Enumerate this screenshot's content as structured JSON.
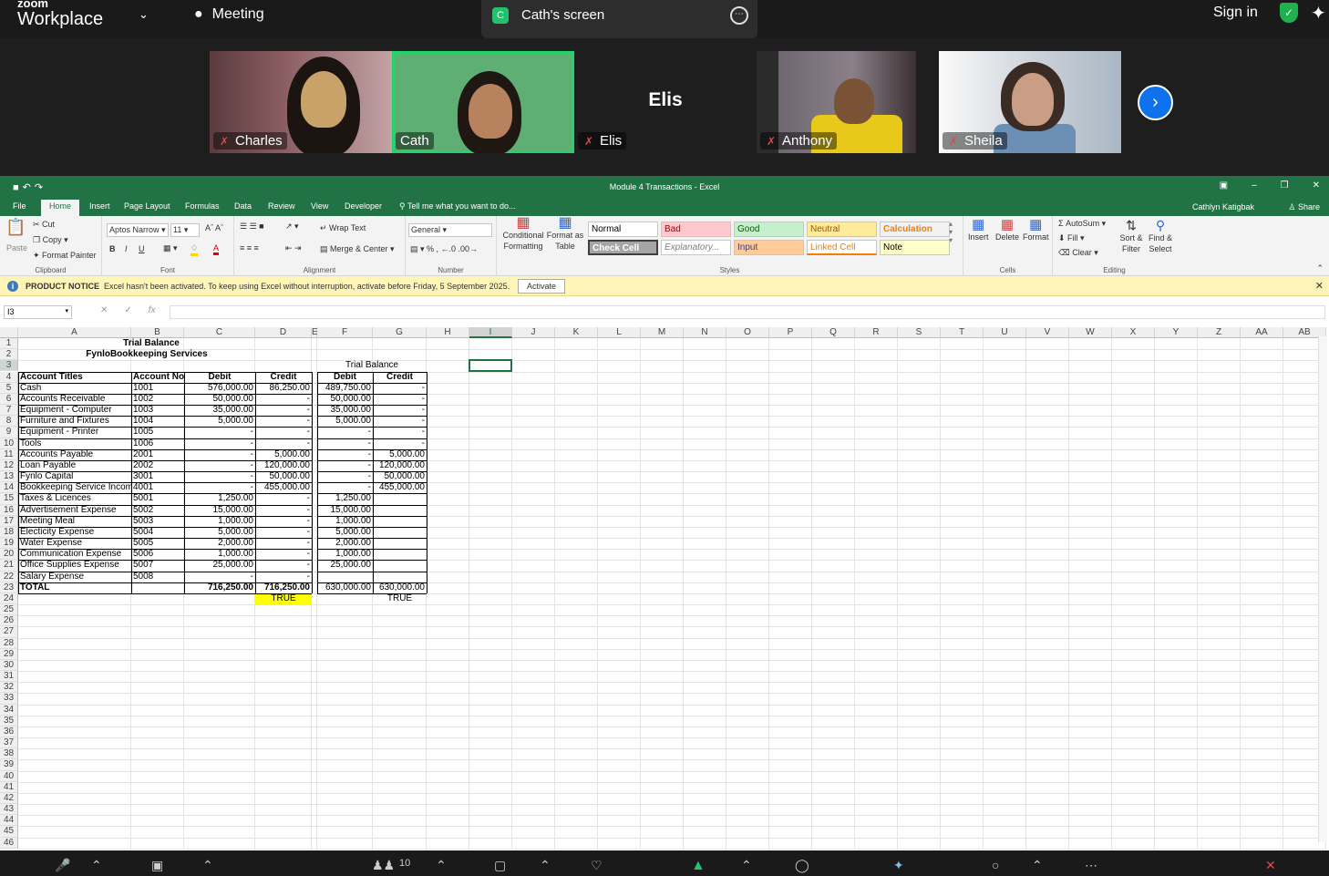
{
  "zoom": {
    "brand_small": "zoom",
    "brand": "Workplace",
    "meeting_label": "Meeting",
    "share_badge": "C",
    "share_title": "Cath's screen",
    "sign_in": "Sign in"
  },
  "participants": [
    {
      "name": "Charles",
      "muted": true
    },
    {
      "name": "Cath",
      "muted": false,
      "active": true
    },
    {
      "name": "Elis",
      "muted": true,
      "video_off": true
    },
    {
      "name": "Anthony",
      "muted": true
    },
    {
      "name": "Sheila",
      "muted": true
    }
  ],
  "excel": {
    "doc_title": "Module 4 Transactions - Excel",
    "tabs": [
      "File",
      "Home",
      "Insert",
      "Page Layout",
      "Formulas",
      "Data",
      "Review",
      "View",
      "Developer"
    ],
    "tell_me": "Tell me what you want to do...",
    "account": "Cathlyn Katigbak",
    "share": "Share",
    "clipboard": {
      "paste": "Paste",
      "cut": "Cut",
      "copy": "Copy",
      "format_painter": "Format Painter",
      "label": "Clipboard"
    },
    "font": {
      "name": "Aptos Narrow",
      "size": "11",
      "bold": "B",
      "italic": "I",
      "underline": "U",
      "label": "Font"
    },
    "alignment": {
      "wrap": "Wrap Text",
      "merge": "Merge & Center",
      "label": "Alignment"
    },
    "number": {
      "format": "General",
      "label": "Number"
    },
    "styles_group": {
      "conditional": "Conditional Formatting",
      "format_table": "Format as Table",
      "label": "Styles"
    },
    "styles": [
      {
        "name": "Normal",
        "bg": "#ffffff",
        "fg": "#000000"
      },
      {
        "name": "Bad",
        "bg": "#ffc7ce",
        "fg": "#9c0006"
      },
      {
        "name": "Good",
        "bg": "#c6efce",
        "fg": "#006100"
      },
      {
        "name": "Neutral",
        "bg": "#ffeb9c",
        "fg": "#9c5700"
      },
      {
        "name": "Calculation",
        "bg": "#f2f2f2",
        "fg": "#fa7d00"
      },
      {
        "name": "Check Cell",
        "bg": "#a5a5a5",
        "fg": "#ffffff"
      },
      {
        "name": "Explanatory...",
        "bg": "#ffffff",
        "fg": "#7f7f7f"
      },
      {
        "name": "Input",
        "bg": "#ffcc99",
        "fg": "#3f3f76"
      },
      {
        "name": "Linked Cell",
        "bg": "#ffffff",
        "fg": "#fa7d00"
      },
      {
        "name": "Note",
        "bg": "#ffffcc",
        "fg": "#000000"
      }
    ],
    "cells_group": {
      "insert": "Insert",
      "delete": "Delete",
      "format": "Format",
      "label": "Cells"
    },
    "editing": {
      "autosum": "AutoSum",
      "fill": "Fill",
      "clear": "Clear",
      "sort": "Sort & Filter",
      "find": "Find & Select",
      "label": "Editing"
    },
    "notice": {
      "title": "PRODUCT NOTICE",
      "text": "Excel hasn't been activated. To keep using Excel without interruption, activate before Friday, 5 September 2025.",
      "button": "Activate"
    },
    "name_box": "I3",
    "columns": [
      "A",
      "B",
      "C",
      "D",
      "E",
      "F",
      "G",
      "H",
      "I",
      "J",
      "K",
      "L",
      "M",
      "N",
      "O",
      "P",
      "Q",
      "R",
      "S",
      "T",
      "U",
      "V",
      "W",
      "X",
      "Y",
      "Z",
      "AA",
      "AB"
    ],
    "sheet": {
      "title": "Trial Balance",
      "company": "FynloBookkeeping Services",
      "adjusted_title": "Trial Balance",
      "headers": [
        "Account Titles",
        "Account No",
        "Debit",
        "Credit",
        "Debit",
        "Credit"
      ],
      "rows": [
        [
          "Cash",
          "1001",
          "576,000.00",
          "86,250.00",
          "489,750.00",
          "-"
        ],
        [
          "Accounts Receivable",
          "1002",
          "50,000.00",
          "-",
          "50,000.00",
          "-"
        ],
        [
          "Equipment - Computer",
          "1003",
          "35,000.00",
          "-",
          "35,000.00",
          "-"
        ],
        [
          "Furniture and Fixtures",
          "1004",
          "5,000.00",
          "-",
          "5,000.00",
          "-"
        ],
        [
          "Equipment - Printer",
          "1005",
          "-",
          "-",
          "-",
          "-"
        ],
        [
          "Tools",
          "1006",
          "-",
          "-",
          "-",
          "-"
        ],
        [
          "Accounts Payable",
          "2001",
          "-",
          "5,000.00",
          "-",
          "5,000.00"
        ],
        [
          "Loan Payable",
          "2002",
          "-",
          "120,000.00",
          "-",
          "120,000.00"
        ],
        [
          "Fynlo Capital",
          "3001",
          "-",
          "50,000.00",
          "-",
          "50,000.00"
        ],
        [
          "Bookkeeping Service Income",
          "4001",
          "-",
          "455,000.00",
          "-",
          "455,000.00"
        ],
        [
          "Taxes & Licences",
          "5001",
          "1,250.00",
          "-",
          "1,250.00",
          ""
        ],
        [
          "Advertisement Expense",
          "5002",
          "15,000.00",
          "-",
          "15,000.00",
          ""
        ],
        [
          "Meeting Meal",
          "5003",
          "1,000.00",
          "-",
          "1,000.00",
          ""
        ],
        [
          "Electicity Expense",
          "5004",
          "5,000.00",
          "-",
          "5,000.00",
          ""
        ],
        [
          "Water Expense",
          "5005",
          "2,000.00",
          "-",
          "2,000.00",
          ""
        ],
        [
          "Communication Expense",
          "5006",
          "1,000.00",
          "-",
          "1,000.00",
          ""
        ],
        [
          "Office Supplies Expense",
          "5007",
          "25,000.00",
          "-",
          "25,000.00",
          ""
        ],
        [
          "Salary Expense",
          "5008",
          "-",
          "-",
          "",
          ""
        ]
      ],
      "total": [
        "TOTAL",
        "",
        "716,250.00",
        "716,250.00",
        "630,000.00",
        "630,000.00"
      ],
      "check_d": "TRUE",
      "check_g": "TRUE"
    }
  },
  "footer": {
    "participants_count": "10"
  }
}
